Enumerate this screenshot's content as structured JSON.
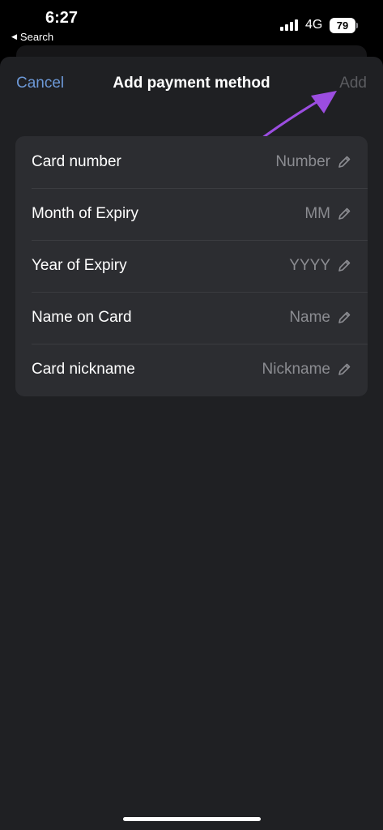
{
  "status_bar": {
    "time": "6:27",
    "back_label": "Search",
    "network": "4G",
    "battery": "79"
  },
  "nav": {
    "cancel_label": "Cancel",
    "title": "Add payment method",
    "add_label": "Add"
  },
  "form": {
    "rows": [
      {
        "label": "Card number",
        "placeholder": "Number"
      },
      {
        "label": "Month of Expiry",
        "placeholder": "MM"
      },
      {
        "label": "Year of Expiry",
        "placeholder": "YYYY"
      },
      {
        "label": "Name on Card",
        "placeholder": "Name"
      },
      {
        "label": "Card nickname",
        "placeholder": "Nickname"
      }
    ]
  },
  "colors": {
    "background": "#1f2023",
    "card": "#2c2d31",
    "accent": "#6c98d6",
    "disabled": "#5b5c60",
    "annotation_arrow": "#9b4de0"
  },
  "icons": {
    "edit": "pencil-icon",
    "back": "back-triangle-icon"
  }
}
